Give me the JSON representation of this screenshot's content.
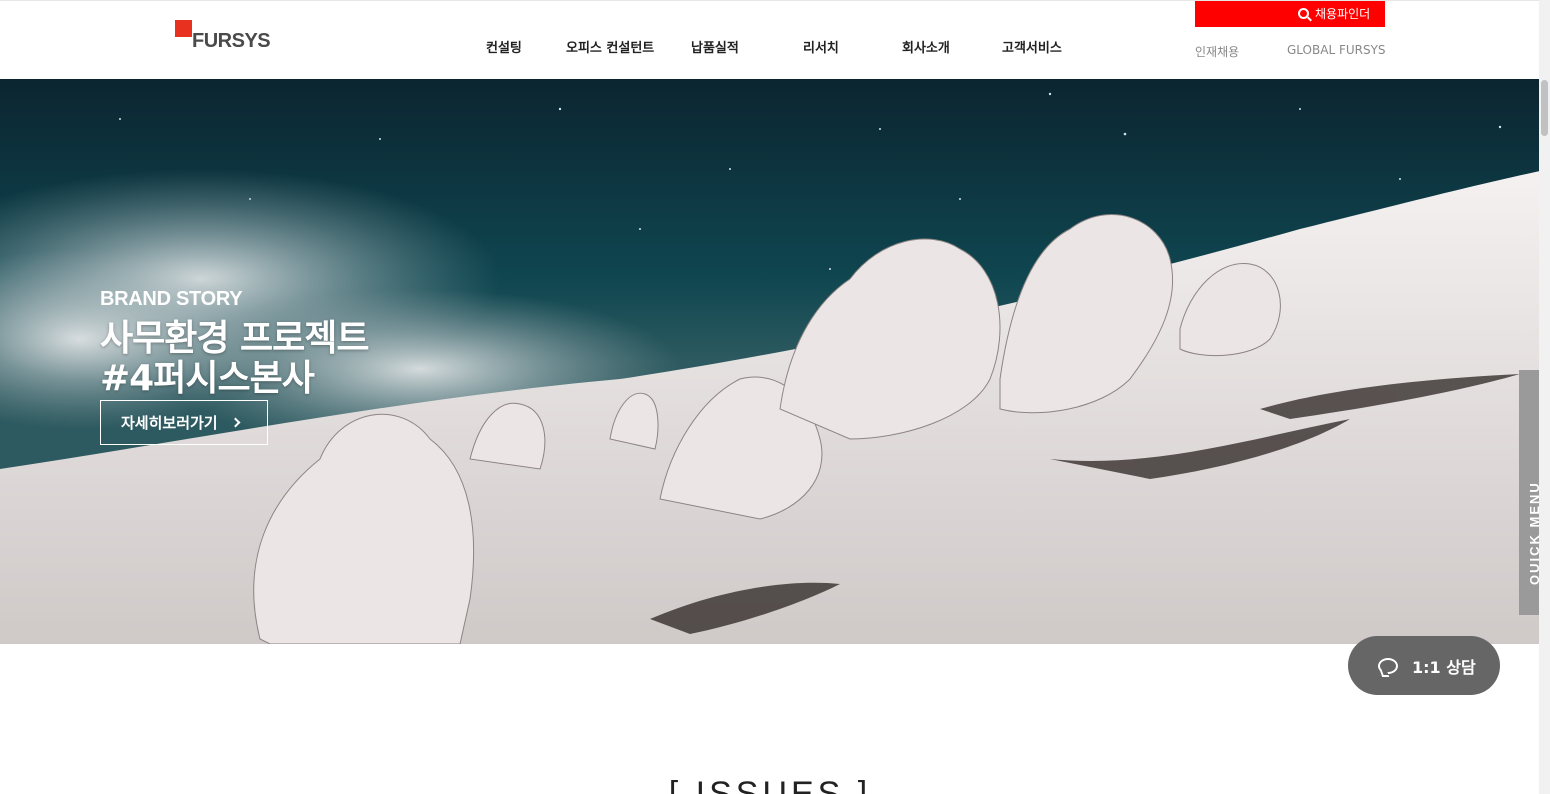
{
  "header": {
    "logo_text": "FURSYS",
    "nav": [
      {
        "label": "컨설팅"
      },
      {
        "label": "오피스 컨설턴트"
      },
      {
        "label": "납품실적"
      },
      {
        "label": "리서치"
      },
      {
        "label": "회사소개"
      },
      {
        "label": "고객서비스"
      }
    ],
    "util_search_label": "채용파인더",
    "util_links": [
      {
        "label": "인재채용"
      },
      {
        "label": "GLOBAL FURSYS"
      }
    ]
  },
  "hero": {
    "eyebrow": "BRAND STORY",
    "title_line1": "사무환경 프로젝트",
    "title_line2": "#4퍼시스본사",
    "button_label": "자세히보러가기"
  },
  "quick_menu": {
    "label": "QUICK MENU"
  },
  "chat": {
    "label": "1:1 상담"
  },
  "issues": {
    "title": "[ ISSUES ]"
  },
  "colors": {
    "brand_red": "#e8311f",
    "util_red": "#ff0000",
    "chat_bg": "#666666",
    "quick_menu_bg": "#9a9a9a"
  },
  "icons": [
    "search-icon",
    "chevron-right-icon",
    "chat-bubble-icon"
  ]
}
